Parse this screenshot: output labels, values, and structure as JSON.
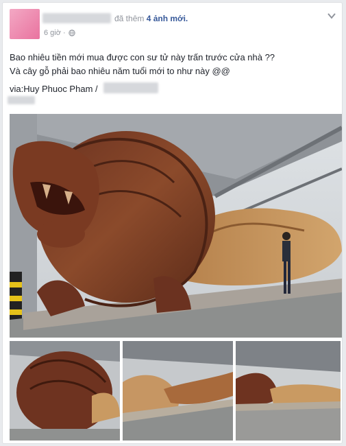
{
  "header": {
    "action_text": "đã thêm",
    "count_text": "4 ảnh mới.",
    "time": "6 giờ ·"
  },
  "post": {
    "line1": "Bao nhiêu tiền mới mua được con sư tử này trấn trước cửa nhà ??",
    "line2": "Và cây gỗ phải bao nhiêu năm tuổi mới to như này @@",
    "via": "via:Huy Phuoc Pham /"
  },
  "icons": [
    "globe-icon",
    "chevron-down-icon"
  ],
  "colors": {
    "link": "#365899",
    "meta": "#90949c",
    "wood": "#8b4a2b"
  }
}
